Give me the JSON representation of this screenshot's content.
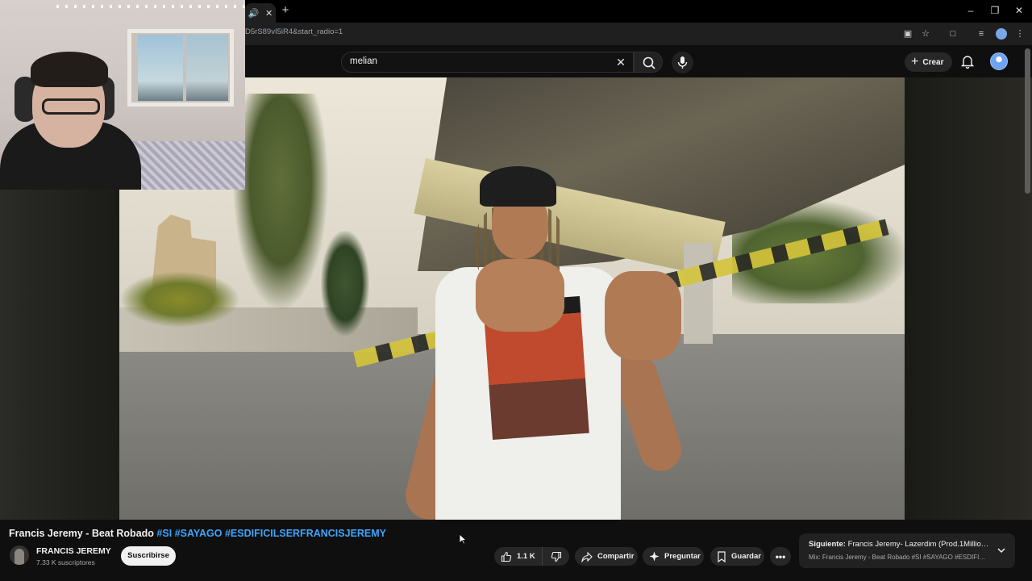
{
  "browser": {
    "tab_audio_icon": "speaker-icon",
    "url": "D5rS89vI5iR4&start_radio=1",
    "window_controls": [
      "minimize",
      "restore",
      "close"
    ]
  },
  "header": {
    "search_value": "melian",
    "create_label": "Crear"
  },
  "video": {
    "title_main": "Francis Jeremy - Beat Robado",
    "hashtags": [
      "#SI",
      "#SAYAGO",
      "#ESDIFICILSERFRANCISJEREMY"
    ]
  },
  "channel": {
    "name": "FRANCIS JEREMY",
    "subscribers": "7.33 K suscriptores",
    "subscribe_label": "Suscribirse"
  },
  "actions": {
    "likes": "1.1 K",
    "share_label": "Compartir",
    "ask_label": "Preguntar",
    "save_label": "Guardar"
  },
  "up_next": {
    "prefix": "Siguiente:",
    "title": "Francis Jeremy- Lazerdim (Prod.1Million...",
    "subtitle": "Mix: Francis Jeremy - Beat Robado #SI #SAYAGO #ESDIFICI..."
  },
  "colors": {
    "background": "#0f0f0f",
    "hashtag": "#3ea6ff",
    "pill": "#272727"
  }
}
